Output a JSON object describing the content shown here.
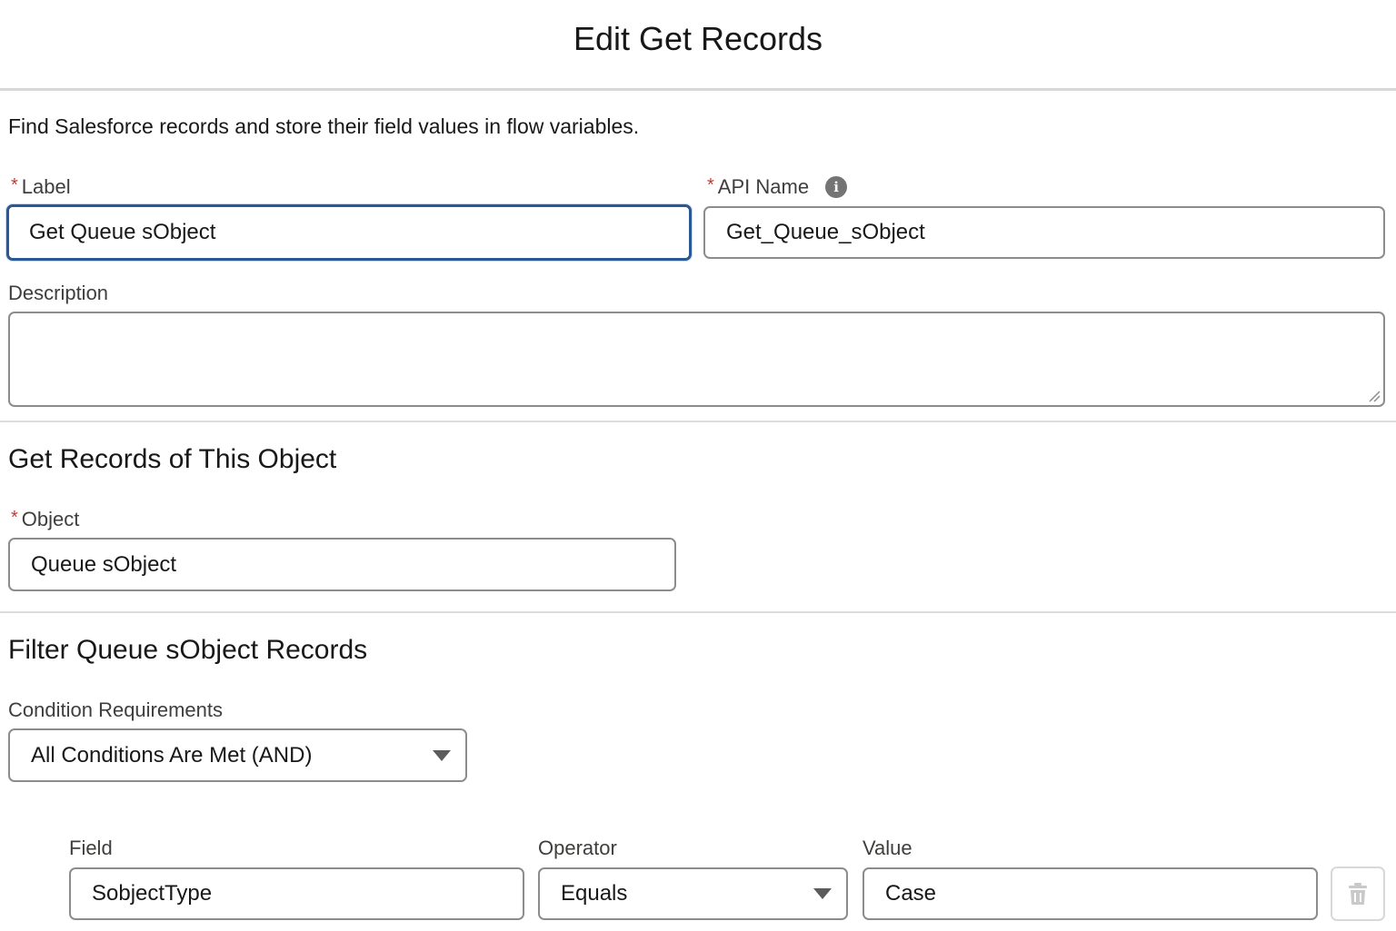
{
  "header": {
    "title": "Edit Get Records"
  },
  "intro": "Find Salesforce records and store their field values in flow variables.",
  "label_field": {
    "label": "Label",
    "value": "Get Queue sObject"
  },
  "api_name_field": {
    "label": "API Name",
    "value": "Get_Queue_sObject",
    "icon": "info-icon"
  },
  "description_field": {
    "label": "Description",
    "value": ""
  },
  "object_section": {
    "title": "Get Records of This Object",
    "object_label": "Object",
    "object_value": "Queue sObject"
  },
  "filter_section": {
    "title": "Filter Queue sObject Records",
    "condition_label": "Condition Requirements",
    "condition_value": "All Conditions Are Met (AND)",
    "columns": {
      "field": "Field",
      "operator": "Operator",
      "value": "Value"
    },
    "rows": [
      {
        "field": "SobjectType",
        "operator": "Equals",
        "value": "Case"
      }
    ]
  },
  "colors": {
    "required": "#c23934",
    "focus_border": "#2c5795",
    "input_border": "#8c8c8c"
  }
}
